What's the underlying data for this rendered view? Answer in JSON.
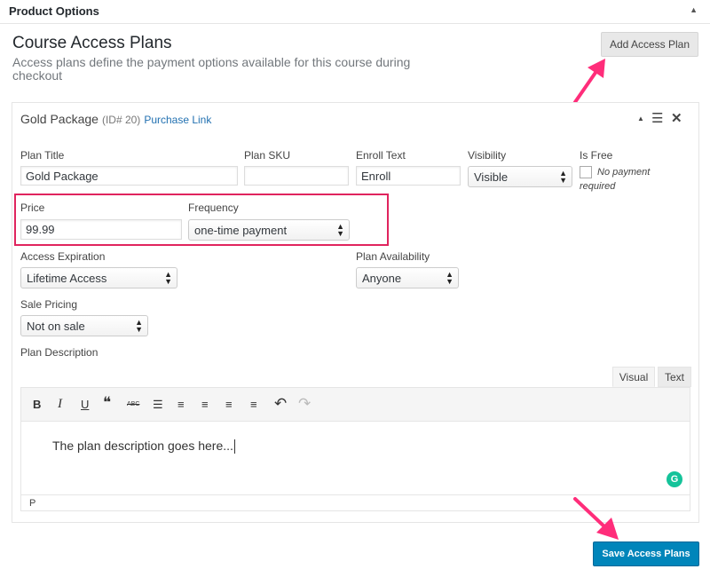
{
  "metabox": {
    "title": "Product Options",
    "toggle_icon": "triangle-up-icon"
  },
  "section": {
    "title": "Course Access Plans",
    "description": "Access plans define the payment options available for this course during checkout",
    "add_button": "Add Access Plan"
  },
  "plan": {
    "name": "Gold Package",
    "id_text": "(ID# 20)",
    "link_text": "Purchase Link",
    "fields": {
      "plan_title": {
        "label": "Plan Title",
        "value": "Gold Package"
      },
      "plan_sku": {
        "label": "Plan SKU",
        "value": ""
      },
      "enroll_text": {
        "label": "Enroll Text",
        "value": "Enroll"
      },
      "visibility": {
        "label": "Visibility",
        "value": "Visible"
      },
      "is_free": {
        "label": "Is Free",
        "hint": "No payment required",
        "checked": false
      },
      "price": {
        "label": "Price",
        "value": "99.99"
      },
      "frequency": {
        "label": "Frequency",
        "value": "one-time payment"
      },
      "access_expiration": {
        "label": "Access Expiration",
        "value": "Lifetime Access"
      },
      "plan_availability": {
        "label": "Plan Availability",
        "value": "Anyone"
      },
      "sale_pricing": {
        "label": "Sale Pricing",
        "value": "Not on sale"
      },
      "plan_description": {
        "label": "Plan Description"
      }
    },
    "editor": {
      "tabs": [
        "Visual",
        "Text"
      ],
      "active_tab": "Visual",
      "content": "The plan description goes here...",
      "status_path": "P",
      "toolbar_glyphs": {
        "bold": "B",
        "italic": "I",
        "underline": "U",
        "quote": "❝",
        "strike": "ABC",
        "bullet": "☰",
        "numbered": "≡",
        "align_left": "≡",
        "align_center": "≡",
        "align_right": "≡",
        "undo": "↶",
        "redo": "↷"
      },
      "grammarly_glyph": "G"
    }
  },
  "save_button": "Save Access Plans",
  "colors": {
    "primary": "#0085ba",
    "highlight": "#e0245e",
    "link": "#2271b1",
    "grammarly": "#15c39a"
  }
}
